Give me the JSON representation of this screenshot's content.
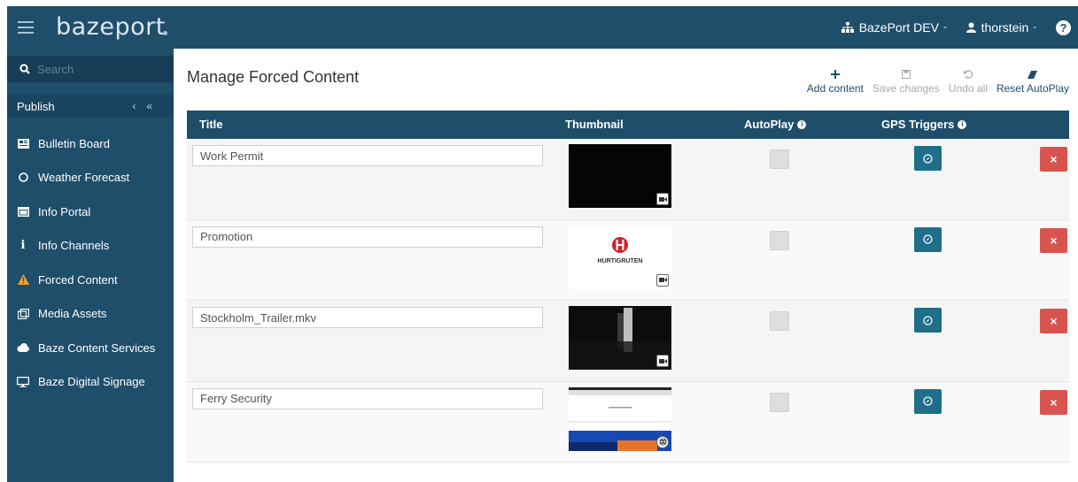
{
  "app": {
    "brand": "bazeport",
    "site_selector": "BazePort DEV",
    "user": "thorstein"
  },
  "sidebar": {
    "search_placeholder": "Search",
    "section": "Publish",
    "items": [
      {
        "label": "Bulletin Board",
        "icon": "bulletin-board-icon"
      },
      {
        "label": "Weather Forecast",
        "icon": "weather-icon"
      },
      {
        "label": "Info Portal",
        "icon": "info-portal-icon"
      },
      {
        "label": "Info Channels",
        "icon": "info-icon"
      },
      {
        "label": "Forced Content",
        "icon": "warning-icon",
        "accent": "#f0a030"
      },
      {
        "label": "Media Assets",
        "icon": "media-assets-icon"
      },
      {
        "label": "Baze Content Services",
        "icon": "cloud-icon"
      },
      {
        "label": "Baze Digital Signage",
        "icon": "monitor-icon"
      }
    ]
  },
  "main": {
    "title": "Manage Forced Content",
    "toolbar": {
      "add": "Add content",
      "save": "Save changes",
      "undo": "Undo all",
      "reset": "Reset AutoPlay"
    },
    "columns": {
      "title": "Title",
      "thumbnail": "Thumbnail",
      "autoplay": "AutoPlay",
      "gps": "GPS Triggers"
    },
    "rows": [
      {
        "title": "Work Permit",
        "thumbnail": "dark-video",
        "autoplay": false
      },
      {
        "title": "Promotion",
        "thumbnail": "hurtigruten-logo",
        "autoplay": false
      },
      {
        "title": "Stockholm_Trailer.mkv",
        "thumbnail": "dark-video-door",
        "autoplay": false
      },
      {
        "title": "Ferry Security",
        "thumbnail": "web-page",
        "autoplay": false
      }
    ],
    "logo_text": "HURTIGRUTEN"
  },
  "colors": {
    "primary": "#1f4e6b",
    "gps_button": "#1f6f8b",
    "delete_button": "#d9534f",
    "warning": "#f0a030"
  }
}
